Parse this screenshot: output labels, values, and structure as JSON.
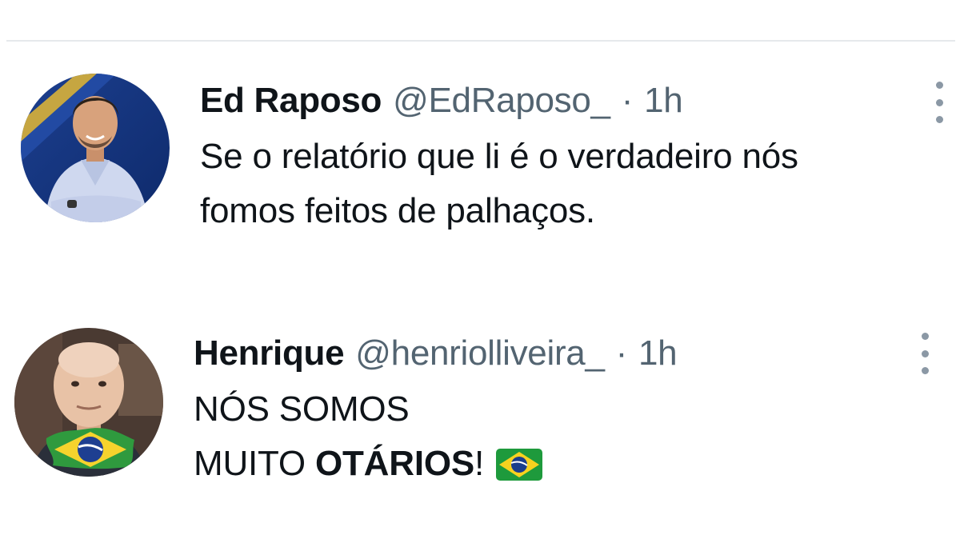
{
  "tweets": [
    {
      "name": "Ed Raposo",
      "handle": "@EdRaposo_",
      "separator": "·",
      "time": "1h",
      "text_lines": [
        "Se o relatório que li é o verdadeiro nós",
        "fomos feitos de palhaços."
      ],
      "avatar": "avatar-man-blue-shirt",
      "menu_icon": "more-vertical-icon"
    },
    {
      "name": "Henrique",
      "handle": "@henriolliveira_",
      "separator": "·",
      "time": "1h",
      "text_line1": "NÓS SOMOS",
      "text_line2_prefix": "MUITO ",
      "text_line2_bold": "OTÁRIOS",
      "text_line2_suffix": "!",
      "emoji": "brazil-flag-icon",
      "avatar": "avatar-man-brazil-flag",
      "menu_icon": "more-vertical-icon"
    }
  ],
  "colors": {
    "text_primary": "#0f1419",
    "text_secondary": "#536471",
    "divider": "#e6e9ec",
    "menu_dots": "#8b98a5"
  }
}
